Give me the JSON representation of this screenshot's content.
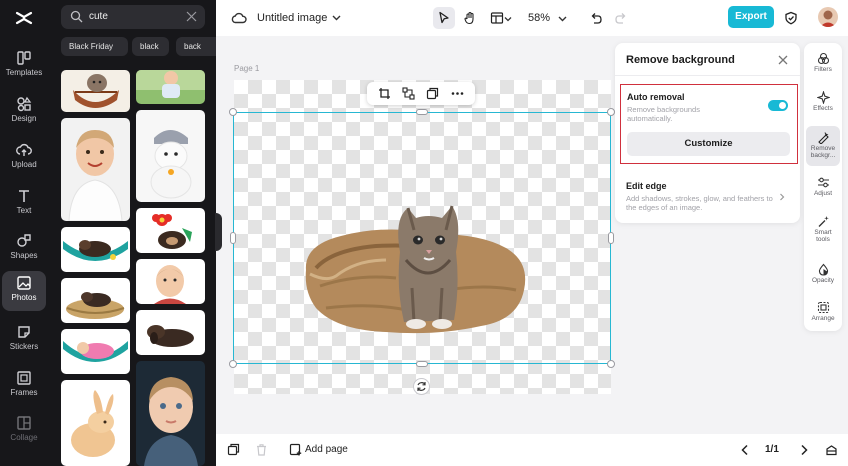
{
  "rail": {
    "items": [
      {
        "label": "Templates",
        "icon": "templates-icon"
      },
      {
        "label": "Design",
        "icon": "design-icon"
      },
      {
        "label": "Upload",
        "icon": "upload-icon"
      },
      {
        "label": "Text",
        "icon": "text-icon"
      },
      {
        "label": "Shapes",
        "icon": "shapes-icon"
      },
      {
        "label": "Photos",
        "icon": "photos-icon",
        "active": true
      },
      {
        "label": "Stickers",
        "icon": "stickers-icon"
      },
      {
        "label": "Frames",
        "icon": "frames-icon"
      },
      {
        "label": "Collage",
        "icon": "collage-icon"
      }
    ]
  },
  "panel": {
    "search_value": "cute",
    "chips": [
      "Black Friday",
      "black",
      "back"
    ]
  },
  "topbar": {
    "doc_title": "Untitled image",
    "zoom": "58%",
    "export_label": "Export"
  },
  "canvas": {
    "page_label": "Page 1"
  },
  "bottombar": {
    "add_page_label": "Add page",
    "pager": "1/1"
  },
  "remove_bg": {
    "title": "Remove background",
    "auto_title": "Auto removal",
    "auto_desc": "Remove backgrounds automatically.",
    "auto_enabled": true,
    "customize_label": "Customize",
    "edge_title": "Edit edge",
    "edge_desc": "Add shadows, strokes, glow, and feathers to the edges of an image."
  },
  "right_rail": {
    "items": [
      {
        "label": "Filters",
        "icon": "filters-icon"
      },
      {
        "label": "Effects",
        "icon": "effects-icon"
      },
      {
        "label": "Remove backgr...",
        "icon": "remove-background-icon",
        "active": true
      },
      {
        "label": "Adjust",
        "icon": "adjust-icon"
      },
      {
        "label": "Smart tools",
        "icon": "smart-tools-icon"
      },
      {
        "label": "Opacity",
        "icon": "opacity-icon"
      },
      {
        "label": "Arrange",
        "icon": "arrange-icon"
      }
    ]
  },
  "colors": {
    "accent": "#18b9d5",
    "highlight_border": "#d0303d",
    "dark_panel": "#17171a"
  }
}
